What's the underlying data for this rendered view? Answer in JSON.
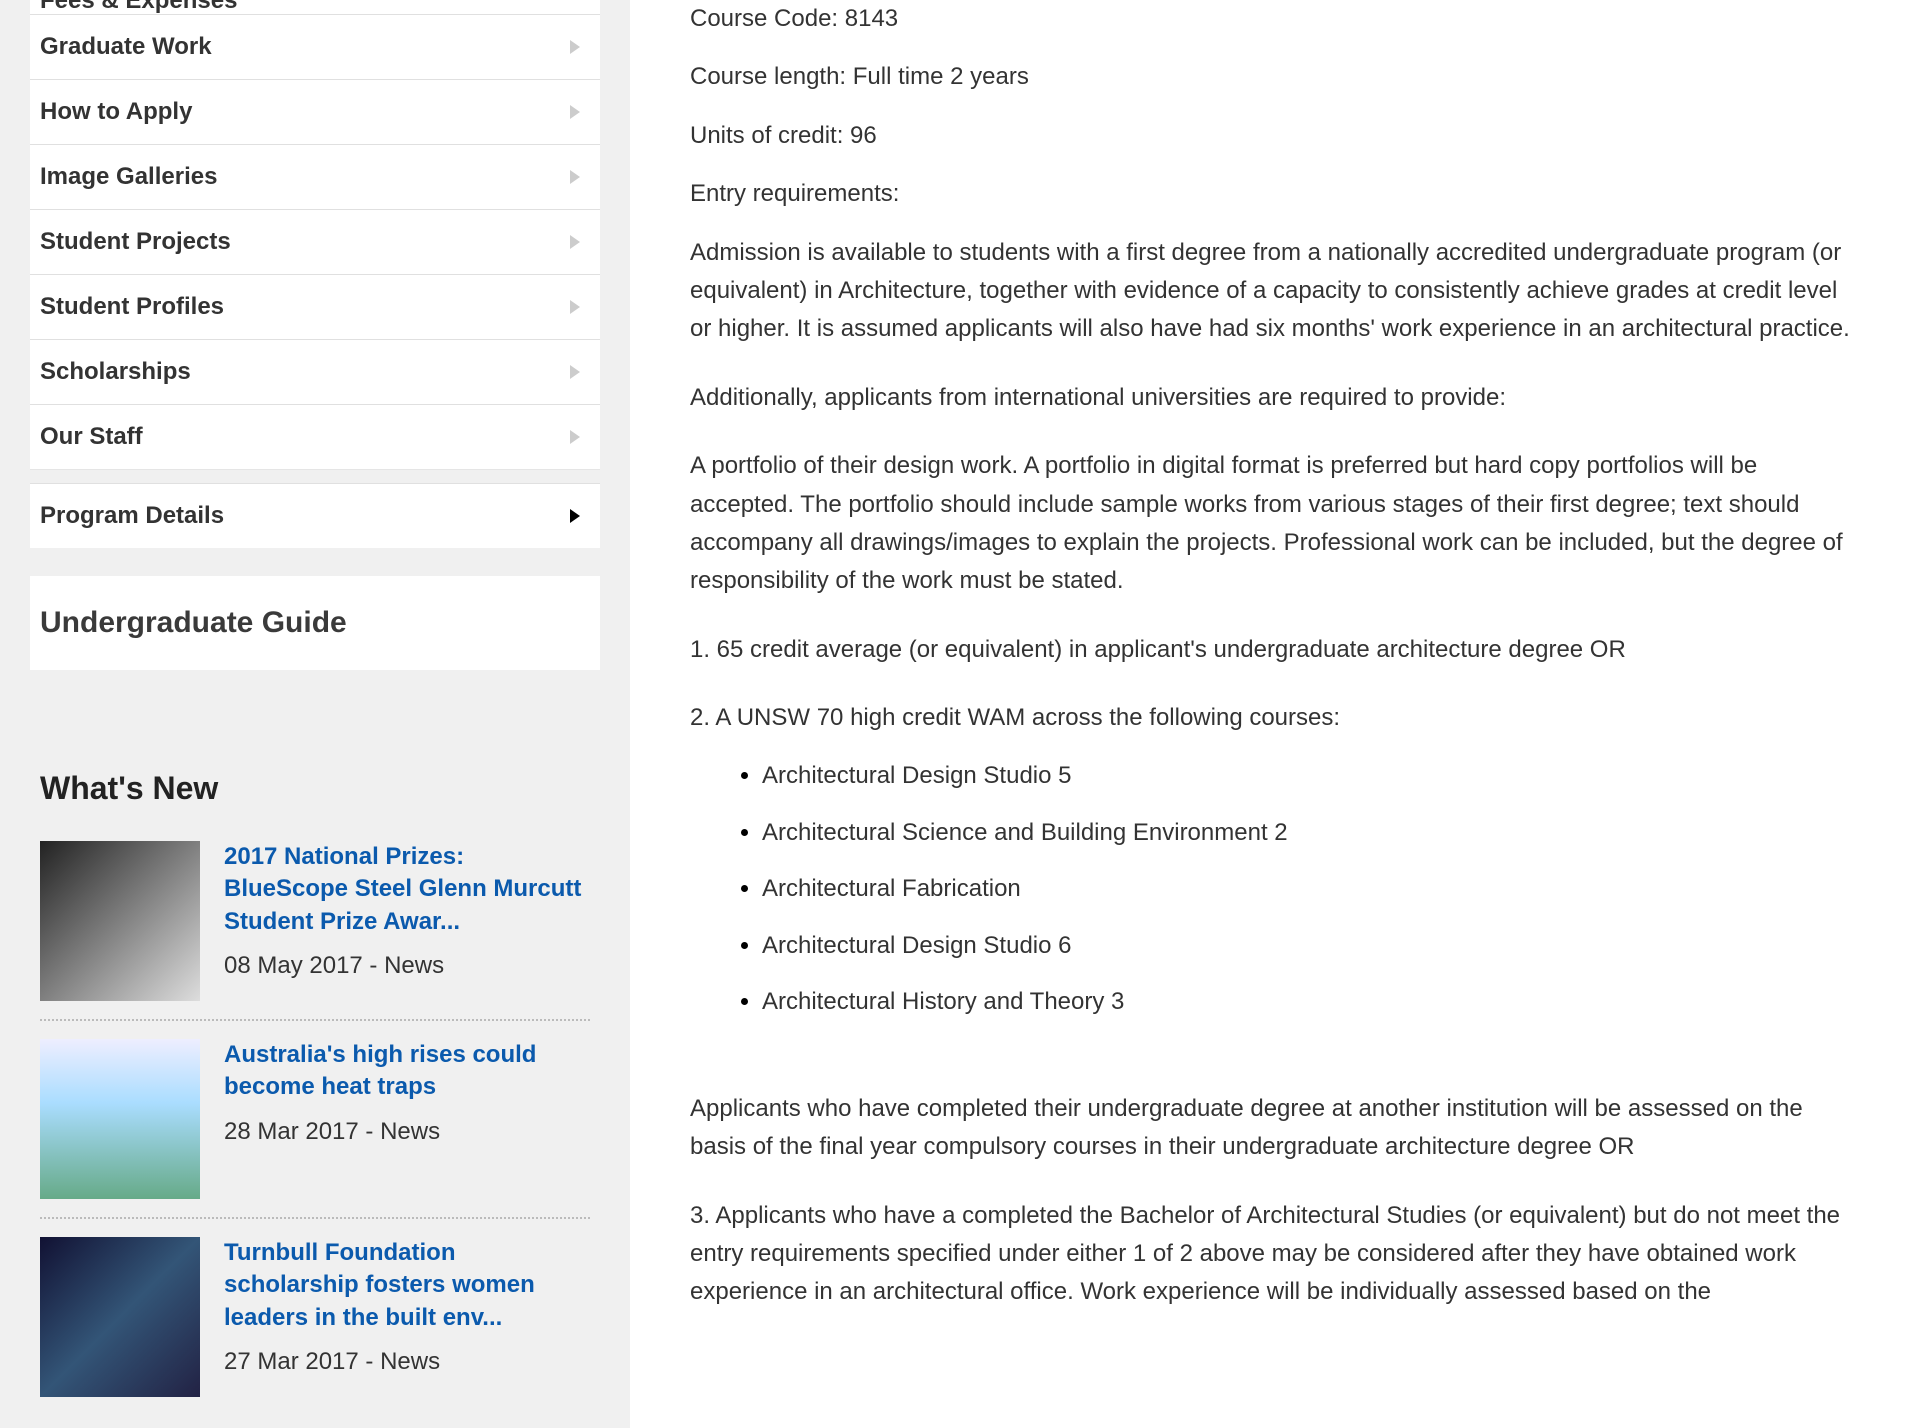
{
  "sidebar": {
    "nav": [
      {
        "label": "Fees & Expenses",
        "expandable": true,
        "active": false,
        "cut": true
      },
      {
        "label": "Graduate Work",
        "expandable": true,
        "active": false
      },
      {
        "label": "How to Apply",
        "expandable": true,
        "active": false
      },
      {
        "label": "Image Galleries",
        "expandable": true,
        "active": false
      },
      {
        "label": "Student Projects",
        "expandable": true,
        "active": false
      },
      {
        "label": "Student Profiles",
        "expandable": true,
        "active": false
      },
      {
        "label": "Scholarships",
        "expandable": true,
        "active": false
      },
      {
        "label": "Our Staff",
        "expandable": true,
        "active": false
      },
      {
        "label": "Program Details",
        "expandable": true,
        "active": true
      }
    ],
    "guide_title": "Undergraduate Guide",
    "whats_new_title": "What's New",
    "news": [
      {
        "title": "2017 National Prizes: BlueScope Steel Glenn Murcutt Student Prize Awar...",
        "meta": "08 May 2017 - News"
      },
      {
        "title": "Australia's high rises could become heat traps",
        "meta": "28 Mar 2017 - News"
      },
      {
        "title": "Turnbull Foundation scholarship fosters women leaders in the built env...",
        "meta": "27 Mar 2017 - News"
      }
    ]
  },
  "main": {
    "course_code": "Course Code: 8143",
    "course_length": "Course length: Full time 2 years",
    "units": "Units of credit: 96",
    "entry_label": "Entry requirements:",
    "p1": "Admission is available to students with a first degree from a nationally accredited undergraduate program (or equivalent) in Architecture, together with evidence of a capacity to consistently achieve grades at credit level or higher. It is assumed applicants will also have had six months' work experience in an architectural practice.",
    "p2": "Additionally, applicants from international universities are required to provide:",
    "p3": "A portfolio of their design work. A portfolio in digital format is preferred but hard copy portfolios will be accepted. The portfolio should include sample works from various stages of their first degree; text should accompany all drawings/images to explain the projects. Professional work can be included, but the degree of responsibility of the work must be stated.",
    "p4": "1. 65 credit average (or equivalent) in applicant's undergraduate architecture degree OR",
    "p5": "2. A UNSW 70 high credit WAM across the following courses:",
    "bullets": [
      "Architectural Design Studio 5",
      "Architectural Science and Building Environment 2",
      "Architectural Fabrication",
      "Architectural Design Studio 6",
      "Architectural History and Theory 3"
    ],
    "p6": "Applicants who have completed their undergraduate degree at another institution will be assessed on the basis of the final year compulsory courses in their undergraduate architecture degree OR",
    "p7": "3. Applicants who have a completed the Bachelor of Architectural Studies (or equivalent) but do not meet the entry requirements specified under either 1 of 2 above may be considered after they have obtained work experience in an architectural office. Work experience will be individually assessed based on the"
  }
}
